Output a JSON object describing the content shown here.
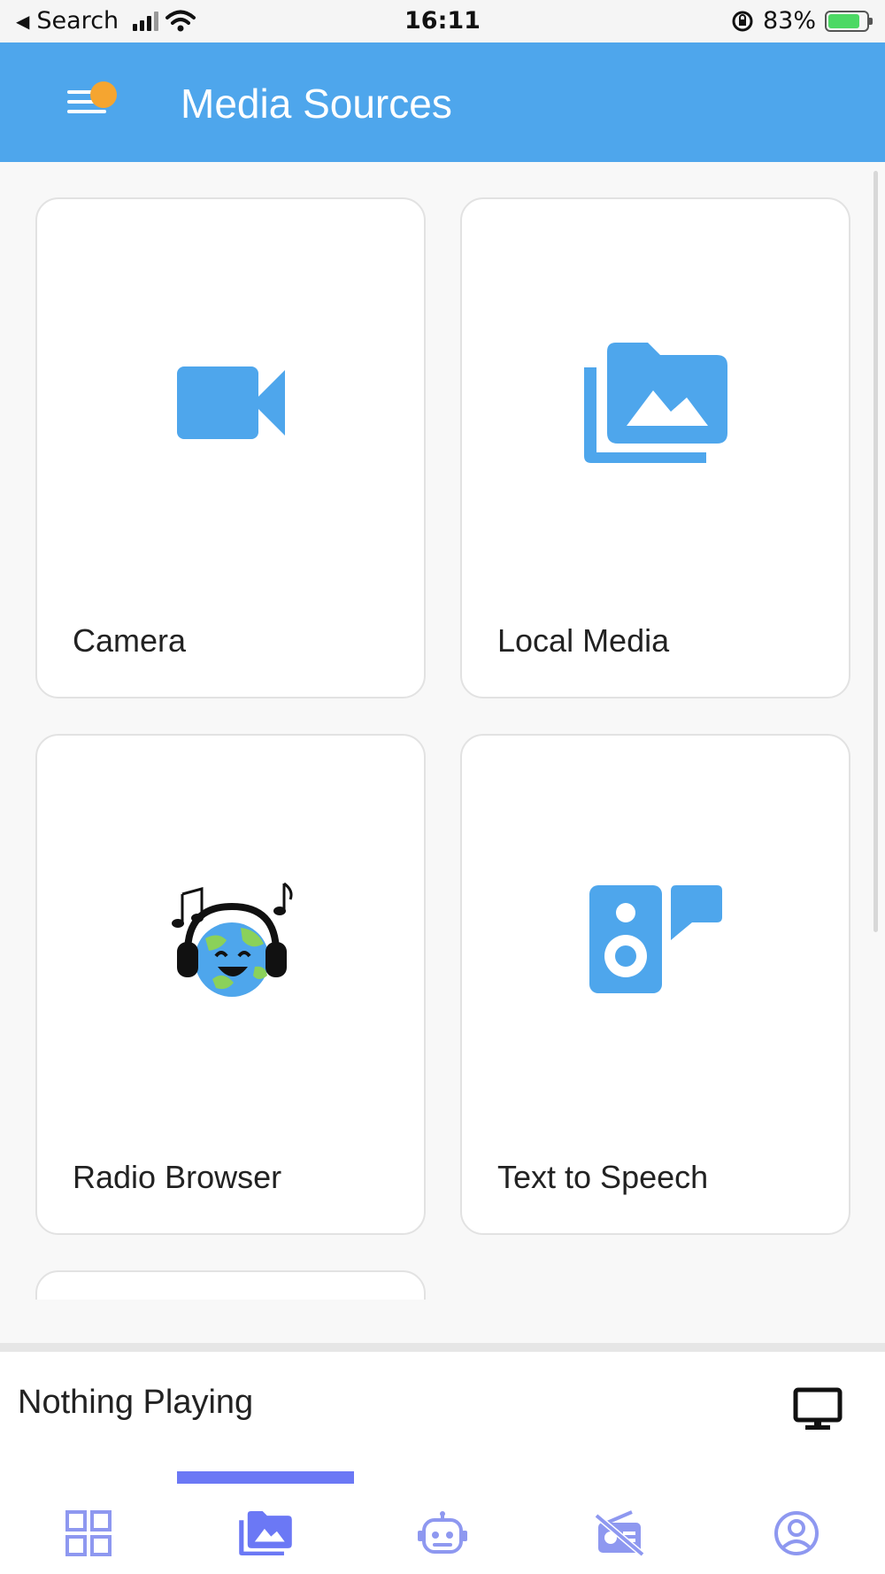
{
  "status_bar": {
    "back_label": "Search",
    "time": "16:11",
    "battery": "83%",
    "battery_level": 0.83
  },
  "app_bar": {
    "title": "Media Sources",
    "menu_icon": "menu-icon",
    "badge_color": "#f5a530",
    "background": "#4ea6ec"
  },
  "sources": [
    {
      "label": "Camera",
      "icon": "video-camera-icon"
    },
    {
      "label": "Local Media",
      "icon": "photo-library-icon"
    },
    {
      "label": "Radio Browser",
      "icon": "globe-headphones-icon"
    },
    {
      "label": "Text to Speech",
      "icon": "speaker-chat-icon"
    }
  ],
  "player": {
    "now_playing": "Nothing Playing",
    "cast_icon": "monitor-icon"
  },
  "bottom_nav": {
    "active_index": 1,
    "active_color": "#6b78f5",
    "items": [
      {
        "icon": "dashboard-icon"
      },
      {
        "icon": "media-icon"
      },
      {
        "icon": "robot-icon"
      },
      {
        "icon": "radio-off-icon"
      },
      {
        "icon": "account-icon"
      }
    ]
  },
  "accent_color": "#4ea6ec"
}
